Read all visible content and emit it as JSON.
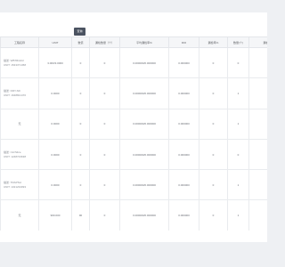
{
  "toolbar": {
    "action_label": "查询"
  },
  "table": {
    "columns": [
      "工程名称",
      "UNIT",
      "数值",
      "漏检数量（个）",
      "平均漏检率%",
      "ROI",
      "漏检率%",
      "数量(个)",
      "漏检占比"
    ],
    "rows": [
      {
        "info": [
          "描述: WB7RHHU",
          "UNIT: 1543371458"
        ],
        "unit": "3.000/3.0000",
        "value": "0",
        "missed": "0",
        "avg_rate": "0.000000/0.000000",
        "roi": "0.000000",
        "miss_rate": "0",
        "count": "0",
        "ratio": "0"
      },
      {
        "info": [
          "描述: DRY-SD",
          "UNIT: 1648821470"
        ],
        "unit": "0.0000",
        "value": "0",
        "missed": "0",
        "avg_rate": "0.000000/0.000000",
        "roi": "0.000000",
        "miss_rate": "0",
        "count": "1",
        "ratio": "1"
      },
      {
        "info": [
          "无"
        ],
        "unit": "0.0000",
        "value": "0",
        "missed": "0",
        "avg_rate": "0.000000/0.000000",
        "roi": "0.000000",
        "miss_rate": "0",
        "count": "1",
        "ratio": "1"
      },
      {
        "info": [
          "描述: Cin/Slice",
          "UNIT: 1248723638"
        ],
        "unit": "0.0000",
        "value": "0",
        "missed": "0",
        "avg_rate": "0.000000/0.000000",
        "roi": "0.000000",
        "miss_rate": "0",
        "count": "0",
        "ratio": "0"
      },
      {
        "info": [
          "描述: TRAPSH",
          "UNIT: 1321234093"
        ],
        "unit": "0.0000",
        "value": "0",
        "missed": "0",
        "avg_rate": "0.000000/0.000000",
        "roi": "0.000000",
        "miss_rate": "0",
        "count": "1",
        "ratio": "1"
      },
      {
        "info": [
          "无"
        ],
        "unit": "900.000",
        "value": "90",
        "missed": "0",
        "avg_rate": "0.000000/0.000000",
        "roi": "0.000000",
        "miss_rate": "0",
        "count": "1",
        "ratio": "1"
      }
    ]
  }
}
